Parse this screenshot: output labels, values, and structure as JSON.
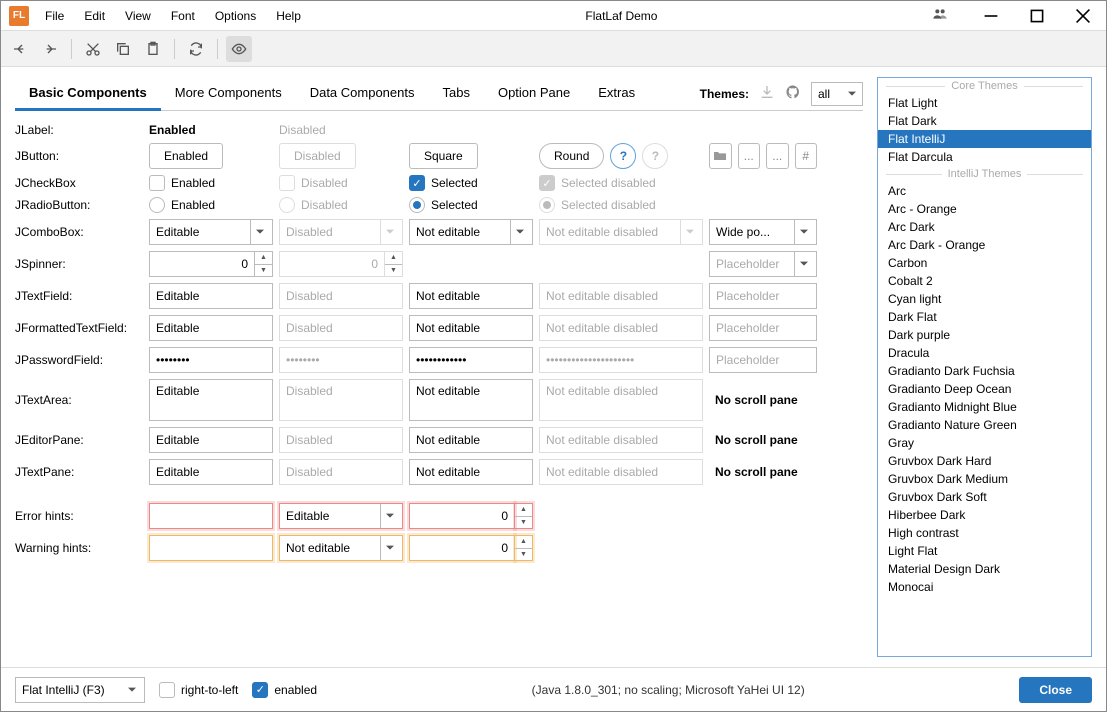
{
  "window": {
    "title": "FlatLaf Demo"
  },
  "menubar": [
    "File",
    "Edit",
    "View",
    "Font",
    "Options",
    "Help"
  ],
  "tabs": {
    "items": [
      "Basic Components",
      "More Components",
      "Data Components",
      "Tabs",
      "Option Pane",
      "Extras"
    ],
    "selected": "Basic Components"
  },
  "themes_panel": {
    "label": "Themes:",
    "filter": "all",
    "core_header": "Core Themes",
    "intellij_header": "IntelliJ Themes",
    "core": [
      "Flat Light",
      "Flat Dark",
      "Flat IntelliJ",
      "Flat Darcula"
    ],
    "selected": "Flat IntelliJ",
    "intellij": [
      "Arc",
      "Arc - Orange",
      "Arc Dark",
      "Arc Dark - Orange",
      "Carbon",
      "Cobalt 2",
      "Cyan light",
      "Dark Flat",
      "Dark purple",
      "Dracula",
      "Gradianto Dark Fuchsia",
      "Gradianto Deep Ocean",
      "Gradianto Midnight Blue",
      "Gradianto Nature Green",
      "Gray",
      "Gruvbox Dark Hard",
      "Gruvbox Dark Medium",
      "Gruvbox Dark Soft",
      "Hiberbee Dark",
      "High contrast",
      "Light Flat",
      "Material Design Dark",
      "Monocai"
    ]
  },
  "form": {
    "rows": {
      "jlabel": {
        "label": "JLabel:",
        "enabled": "Enabled",
        "disabled": "Disabled"
      },
      "jbutton": {
        "label": "JButton:",
        "enabled": "Enabled",
        "disabled": "Disabled",
        "square": "Square",
        "round": "Round",
        "hash": "#",
        "dots": "..."
      },
      "jcheckbox": {
        "label": "JCheckBox",
        "enabled": "Enabled",
        "disabled": "Disabled",
        "selected": "Selected",
        "selected_disabled": "Selected disabled"
      },
      "jradio": {
        "label": "JRadioButton:",
        "enabled": "Enabled",
        "disabled": "Disabled",
        "selected": "Selected",
        "selected_disabled": "Selected disabled"
      },
      "jcombo": {
        "label": "JComboBox:",
        "editable": "Editable",
        "disabled": "Disabled",
        "not_editable": "Not editable",
        "not_editable_disabled": "Not editable disabled",
        "wide": "Wide po..."
      },
      "jspinner": {
        "label": "JSpinner:",
        "v1": "0",
        "v2": "0",
        "placeholder": "Placeholder"
      },
      "jtextfield": {
        "label": "JTextField:",
        "editable": "Editable",
        "disabled": "Disabled",
        "not_editable": "Not editable",
        "not_editable_disabled": "Not editable disabled",
        "placeholder": "Placeholder"
      },
      "jformatted": {
        "label": "JFormattedTextField:",
        "editable": "Editable",
        "disabled": "Disabled",
        "not_editable": "Not editable",
        "not_editable_disabled": "Not editable disabled",
        "placeholder": "Placeholder"
      },
      "jpassword": {
        "label": "JPasswordField:",
        "v": "••••••••",
        "v2": "••••••••",
        "v3": "••••••••••••",
        "v4": "•••••••••••••••••••••",
        "placeholder": "Placeholder"
      },
      "jtextarea": {
        "label": "JTextArea:",
        "editable": "Editable",
        "disabled": "Disabled",
        "not_editable": "Not editable",
        "not_editable_disabled": "Not editable disabled",
        "no_scroll": "No scroll pane"
      },
      "jeditor": {
        "label": "JEditorPane:",
        "editable": "Editable",
        "disabled": "Disabled",
        "not_editable": "Not editable",
        "not_editable_disabled": "Not editable disabled",
        "no_scroll": "No scroll pane"
      },
      "jtextpane": {
        "label": "JTextPane:",
        "editable": "Editable",
        "disabled": "Disabled",
        "not_editable": "Not editable",
        "not_editable_disabled": "Not editable disabled",
        "no_scroll": "No scroll pane"
      },
      "error": {
        "label": "Error hints:",
        "combo": "Editable",
        "spin": "0"
      },
      "warn": {
        "label": "Warning hints:",
        "combo": "Not editable",
        "spin": "0"
      }
    }
  },
  "statusbar": {
    "theme_combo": "Flat IntelliJ (F3)",
    "rtl": "right-to-left",
    "enabled": "enabled",
    "info": "(Java 1.8.0_301; no scaling; Microsoft YaHei UI 12)",
    "close": "Close"
  }
}
